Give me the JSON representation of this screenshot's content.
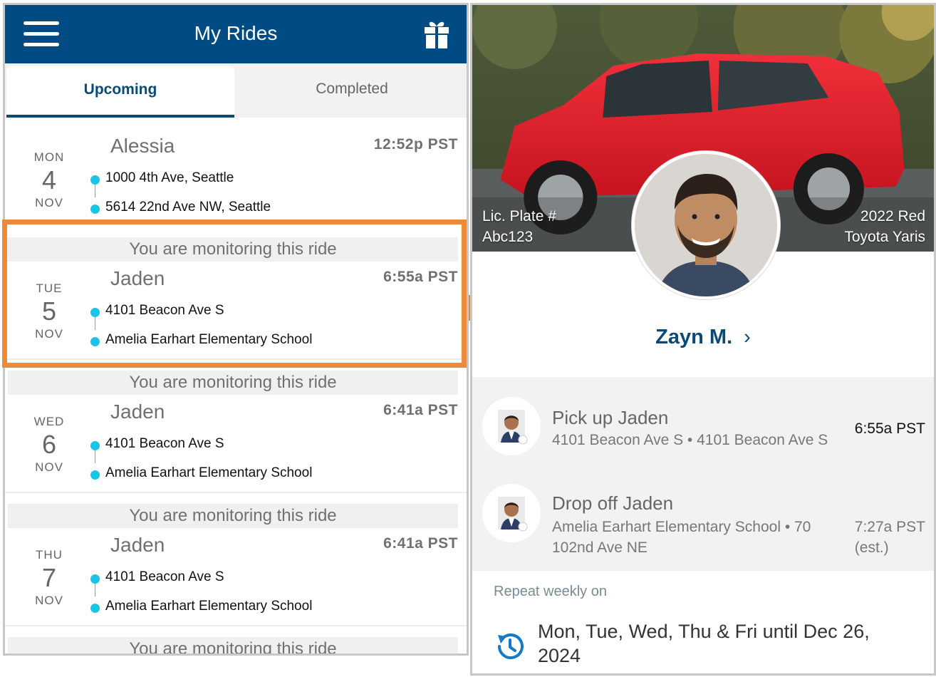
{
  "left": {
    "header": {
      "title": "My Rides",
      "menu_icon": "hamburger-menu-icon",
      "gift_icon": "gift-icon",
      "color": "#004b84"
    },
    "tabs": [
      {
        "label": "Upcoming",
        "active": true
      },
      {
        "label": "Completed",
        "active": false
      }
    ],
    "monitor_text": "You are monitoring this ride",
    "rides": [
      {
        "dow": "MON",
        "day": "4",
        "month": "NOV",
        "rider": "Alessia",
        "time": "12:52p PST",
        "pickup": "1000 4th Ave, Seattle",
        "dropoff": "5614 22nd Ave NW, Seattle",
        "monitoring": false
      },
      {
        "dow": "TUE",
        "day": "5",
        "month": "NOV",
        "rider": "Jaden",
        "time": "6:55a PST",
        "pickup": "4101 Beacon Ave S",
        "dropoff": "Amelia Earhart Elementary School",
        "monitoring": true
      },
      {
        "dow": "WED",
        "day": "6",
        "month": "NOV",
        "rider": "Jaden",
        "time": "6:41a PST",
        "pickup": "4101 Beacon Ave S",
        "dropoff": "Amelia Earhart Elementary School",
        "monitoring": true
      },
      {
        "dow": "THU",
        "day": "7",
        "month": "NOV",
        "rider": "Jaden",
        "time": "6:41a PST",
        "pickup": "4101 Beacon Ave S",
        "dropoff": "Amelia Earhart Elementary School",
        "monitoring": true
      }
    ],
    "accent_color": "#ee8b3a",
    "dot_color": "#1ac4e6"
  },
  "right": {
    "car": {
      "plate_label": "Lic. Plate #",
      "plate": "Abc123",
      "year_color": "2022 Red",
      "model": "Toyota Yaris"
    },
    "driver": {
      "name": "Zayn M.",
      "chevron": "›"
    },
    "stops": [
      {
        "title": "Pick up Jaden",
        "address": "4101 Beacon Ave S • 4101 Beacon Ave S",
        "time": "6:55a PST",
        "time_note": ""
      },
      {
        "title": "Drop off Jaden",
        "address": "Amelia Earhart Elementary School • 70 102nd Ave NE",
        "time": "7:27a PST",
        "time_note": "(est.)"
      }
    ],
    "repeat": {
      "label": "Repeat weekly on",
      "text": "Mon, Tue, Wed, Thu & Fri until Dec 26, 2024",
      "icon": "repeat-clock-icon"
    }
  }
}
